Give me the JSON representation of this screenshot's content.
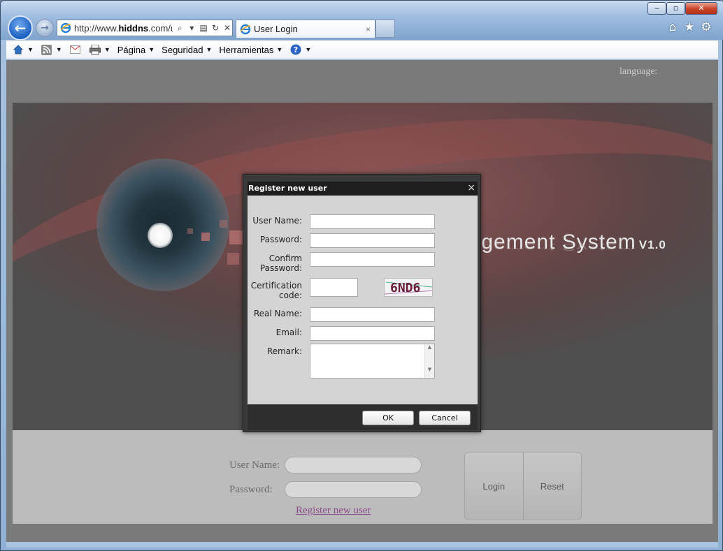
{
  "browser": {
    "address_prefix": "http://www.",
    "address_domain": "hiddns",
    "address_suffix": ".com/u",
    "tab_title": "User Login",
    "tab_close": "×",
    "min": "‒",
    "max": "▫",
    "close": "✕"
  },
  "commandbar": {
    "page_label": "Página",
    "safety_label": "Seguridad",
    "tools_label": "Herramientas"
  },
  "page": {
    "language_label": "language:",
    "banner_title": "nagement System",
    "banner_version": "V1.0",
    "login": {
      "username_label": "User Name:",
      "password_label": "Password:",
      "register_link": "Register new user",
      "login_button": "Login",
      "reset_button": "Reset"
    }
  },
  "modal": {
    "title": "Register new user",
    "close": "×",
    "fields": {
      "username": "User Name:",
      "password": "Password:",
      "confirm1": "Confirm",
      "confirm2": "Password:",
      "cert1": "Certification",
      "cert2": "code:",
      "realname": "Real Name:",
      "email": "Email:",
      "remark": "Remark:"
    },
    "captcha": "6ND6",
    "ok_label": "OK",
    "cancel_label": "Cancel"
  }
}
